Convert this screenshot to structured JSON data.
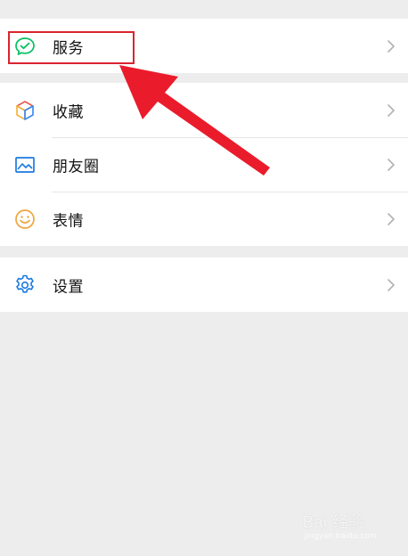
{
  "menu": {
    "group1": [
      {
        "label": "服务",
        "icon": "wechat-pay-service-icon",
        "icon_color": "#07c160"
      }
    ],
    "group2": [
      {
        "label": "收藏",
        "icon": "favorites-cube-icon"
      },
      {
        "label": "朋友圈",
        "icon": "moments-picture-icon",
        "icon_color": "#1a7ae2"
      },
      {
        "label": "表情",
        "icon": "smiley-face-icon",
        "icon_color": "#f0a43c"
      }
    ],
    "group3": [
      {
        "label": "设置",
        "icon": "gear-settings-icon",
        "icon_color": "#1a7ae2"
      }
    ]
  },
  "annotation": {
    "highlight_color": "#d9242f",
    "arrow_color": "#ea1c2b"
  },
  "watermark": {
    "brand": "Bai 经验",
    "url": "jingyan.baidu.com"
  },
  "colors": {
    "background": "#ededed",
    "row_background": "#ffffff",
    "chevron": "#b2b2b2"
  }
}
